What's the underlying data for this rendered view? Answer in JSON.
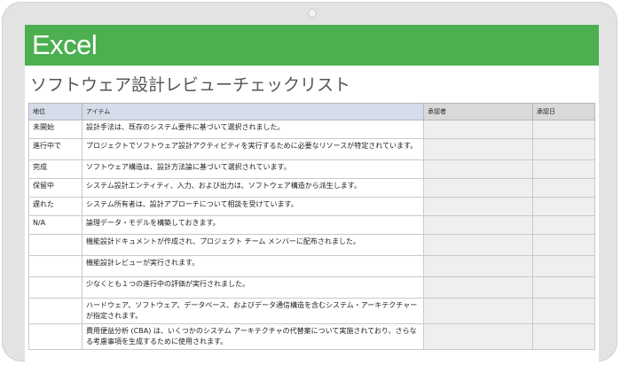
{
  "app": {
    "name": "Excel"
  },
  "sheet": {
    "title": "ソフトウェア設計レビューチェックリスト",
    "columns": [
      "地位",
      "アイテム",
      "承認者",
      "承認日"
    ],
    "rows": [
      {
        "status": "未開始",
        "item": "設計手法は、既存のシステム要件に基づいて選択されました。",
        "approver": "",
        "date": ""
      },
      {
        "status": "進行中で",
        "item": "プロジェクトでソフトウェア設計アクティビティを実行するために必要なリソースが特定されています。",
        "approver": "",
        "date": ""
      },
      {
        "status": "完成",
        "item": "ソフトウェア構造は、設計方法論に基づいて選択されています。",
        "approver": "",
        "date": ""
      },
      {
        "status": "保留中",
        "item": "システム設計エンティティ、入力、および出力は、ソフトウェア構造から派生します。",
        "approver": "",
        "date": ""
      },
      {
        "status": "遅れた",
        "item": "システム所有者は、設計アプローチについて相談を受けています。",
        "approver": "",
        "date": ""
      },
      {
        "status": "N/A",
        "item": "論理データ・モデルを構築しておきます。",
        "approver": "",
        "date": ""
      },
      {
        "status": "",
        "item": "機能設計ドキュメントが作成され、プロジェクト チーム メンバーに配布されました。",
        "approver": "",
        "date": ""
      },
      {
        "status": "",
        "item": "機能設計レビューが実行されます。",
        "approver": "",
        "date": ""
      },
      {
        "status": "",
        "item": "少なくとも１つの進行中の評価が実行されました。",
        "approver": "",
        "date": ""
      },
      {
        "status": "",
        "item": "ハードウェア、ソフトウェア、データベース、およびデータ通信構造を含むシステム・アーキテクチャーが指定されます。",
        "approver": "",
        "date": ""
      },
      {
        "status": "",
        "item": "費用便益分析 (CBA) は、いくつかのシステム アーキテクチャの代替案について実施されており、さらなる考慮事項を生成するために使用されます。",
        "approver": "",
        "date": ""
      }
    ]
  }
}
